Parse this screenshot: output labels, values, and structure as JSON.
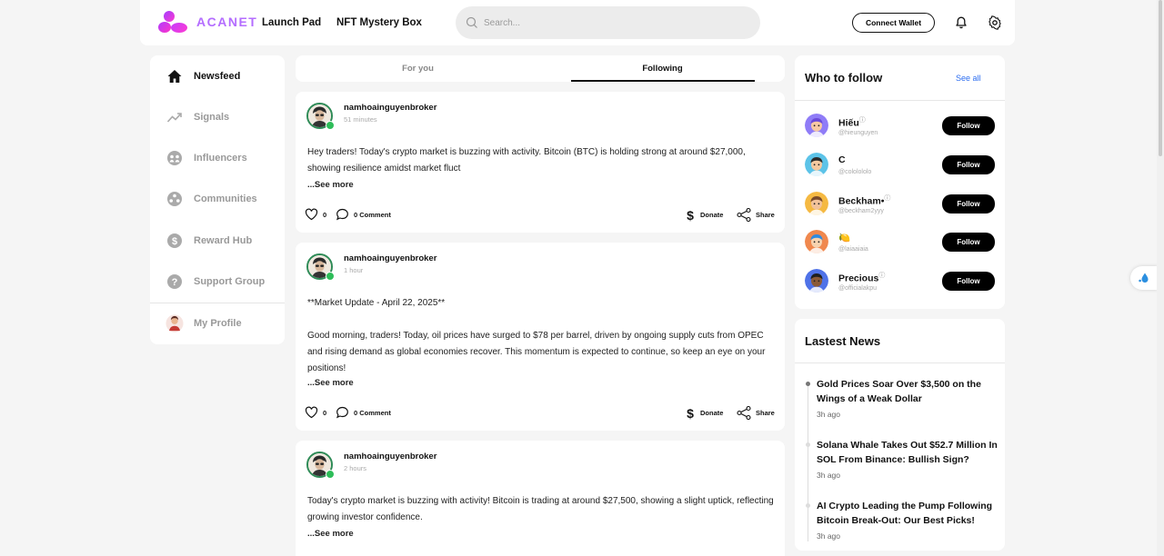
{
  "header": {
    "brand": "ACANET",
    "nav": [
      "Launch Pad",
      "NFT Mystery Box"
    ],
    "search_placeholder": "Search...",
    "connect_wallet": "Connect Wallet",
    "icons": [
      "bell-icon",
      "gear-icon"
    ]
  },
  "sidebar": {
    "items": [
      {
        "label": "Newsfeed",
        "icon": "home-icon",
        "active": true
      },
      {
        "label": "Signals",
        "icon": "trend-icon",
        "active": false
      },
      {
        "label": "Influencers",
        "icon": "influencers-icon",
        "active": false
      },
      {
        "label": "Communities",
        "icon": "communities-icon",
        "active": false
      },
      {
        "label": "Reward Hub",
        "icon": "dollar-icon",
        "active": false
      },
      {
        "label": "Support Group",
        "icon": "help-icon",
        "active": false
      },
      {
        "label": "My Profile",
        "icon": "avatar",
        "active": false
      }
    ]
  },
  "tabs": {
    "for_you": "For you",
    "following": "Following",
    "active": "Following"
  },
  "posts": [
    {
      "author": "namhoainguyenbroker",
      "time": "51 minutes",
      "paragraphs": [
        "Hey traders! Today's crypto market is buzzing with activity. Bitcoin (BTC) is holding strong at around $27,000, showing resilience amidst market fluct"
      ],
      "see_more": "...See more",
      "likes": "0",
      "comments": "0 Comment",
      "donate": "Donate",
      "share": "Share"
    },
    {
      "author": "namhoainguyenbroker",
      "time": "1 hour",
      "paragraphs": [
        "**Market Update - April 22, 2025**",
        "Good morning, traders! Today, oil prices have surged to $78 per barrel, driven by ongoing supply cuts from OPEC and rising demand as global economies recover. This momentum is expected to continue, so keep an eye on your positions!"
      ],
      "see_more": "...See more",
      "likes": "0",
      "comments": "0 Comment",
      "donate": "Donate",
      "share": "Share"
    },
    {
      "author": "namhoainguyenbroker",
      "time": "2 hours",
      "paragraphs": [
        "Today's crypto market is buzzing with activity! Bitcoin is trading at around $27,500, showing a slight uptick, reflecting growing investor confidence."
      ],
      "see_more": "...See more"
    }
  ],
  "who_to_follow": {
    "title": "Who to follow",
    "see_all": "See all",
    "follow_label": "Follow",
    "users": [
      {
        "name": "Hiếu",
        "handle": "@hieunguyen",
        "bg": "#8f7cf7",
        "skin": "#f7c9a4",
        "hair": "#6a4ad9"
      },
      {
        "name": "C",
        "handle": "@cololololo",
        "bg": "#5cc3e8",
        "skin": "#f4c9a0",
        "hair": "#2b2b2b"
      },
      {
        "name": "Beckham•",
        "handle": "@beckham2yyy",
        "bg": "#f5b942",
        "skin": "#f2c29a",
        "hair": "#7a4a2a"
      },
      {
        "name": "🍋",
        "handle": "@laiaaiaia",
        "bg": "#f0884e",
        "skin": "#f6d3b0",
        "hair": "#2f8be0"
      },
      {
        "name": "Precious",
        "handle": "@officialakpu",
        "bg": "#4f72e8",
        "skin": "#8a5a38",
        "hair": "#1f1f1f"
      }
    ]
  },
  "latest_news": {
    "title": "Lastest News",
    "items": [
      {
        "headline": "Gold Prices Soar Over $3,500 on the Wings of a Weak Dollar",
        "time": "3h ago"
      },
      {
        "headline": "Solana Whale Takes Out $52.7 Million In SOL From Binance: Bullish Sign?",
        "time": "3h ago"
      },
      {
        "headline": "AI Crypto Leading the Pump Following Bitcoin Break-Out: Our Best Picks!",
        "time": "3h ago"
      }
    ]
  }
}
